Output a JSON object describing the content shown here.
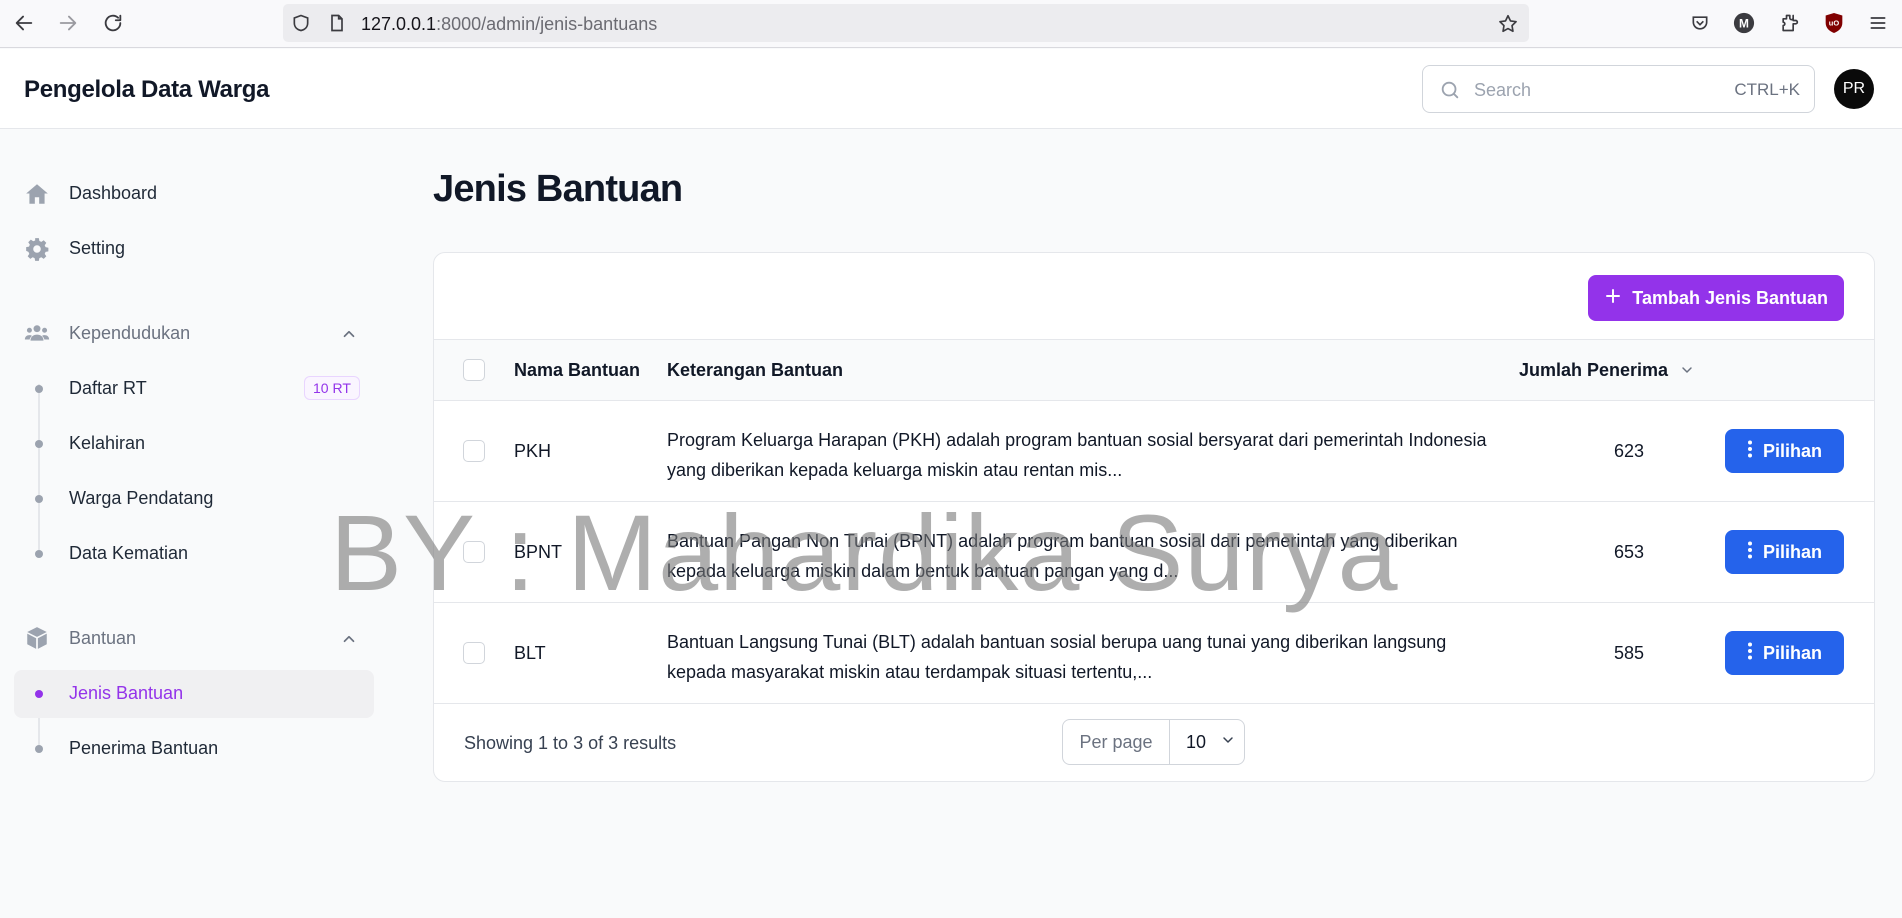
{
  "browser": {
    "url_host": "127.0.0.1",
    "url_path": ":8000/admin/jenis-bantuans"
  },
  "app": {
    "brand": "Pengelola Data Warga",
    "search_placeholder": "Search",
    "search_shortcut": "CTRL+K",
    "avatar_initials": "PR"
  },
  "sidebar": {
    "dashboard": "Dashboard",
    "setting": "Setting",
    "group_kependudukan": "Kependudukan",
    "daftar_rt": "Daftar RT",
    "daftar_rt_badge": "10 RT",
    "kelahiran": "Kelahiran",
    "warga_pendatang": "Warga Pendatang",
    "data_kematian": "Data Kematian",
    "group_bantuan": "Bantuan",
    "jenis_bantuan": "Jenis Bantuan",
    "penerima_bantuan": "Penerima Bantuan"
  },
  "main": {
    "title": "Jenis Bantuan",
    "create_button": "Tambah Jenis Bantuan",
    "columns": {
      "name": "Nama Bantuan",
      "desc": "Keterangan Bantuan",
      "count": "Jumlah Penerima"
    },
    "rows": [
      {
        "name": "PKH",
        "desc": "Program Keluarga Harapan (PKH) adalah program bantuan sosial bersyarat dari pemerintah Indonesia yang diberikan kepada keluarga miskin atau rentan mis...",
        "count": "623",
        "action": "Pilihan"
      },
      {
        "name": "BPNT",
        "desc": "Bantuan Pangan Non Tunai (BPNT) adalah program bantuan sosial dari pemerintah yang diberikan kepada keluarga miskin dalam bentuk bantuan pangan yang d...",
        "count": "653",
        "action": "Pilihan"
      },
      {
        "name": "BLT",
        "desc": "Bantuan Langsung Tunai (BLT) adalah bantuan sosial berupa uang tunai yang diberikan langsung kepada masyarakat miskin atau terdampak situasi tertentu,...",
        "count": "585",
        "action": "Pilihan"
      }
    ],
    "results_text": "Showing 1 to 3 of 3 results",
    "per_page_label": "Per page",
    "per_page_value": "10"
  },
  "watermark": "BY : Mahardika Surya",
  "colors": {
    "primary": "#9333ea",
    "action": "#2563eb"
  }
}
